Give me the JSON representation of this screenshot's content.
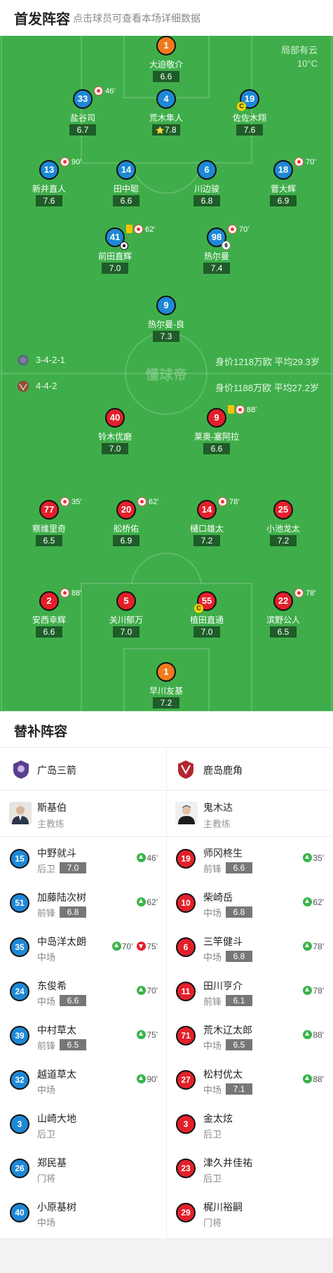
{
  "header": {
    "title": "首发阵容",
    "subtitle": "点击球员可查看本场详细数据"
  },
  "weather": {
    "condition": "局部有云",
    "temperature": "10°C"
  },
  "watermark": "懂球帝",
  "home_team": {
    "name": "广岛三箭",
    "formation": "3-4-2-1",
    "value": "身价1218万欧  平均29.3岁",
    "color": "#5b3f8f"
  },
  "away_team": {
    "name": "鹿岛鹿角",
    "formation": "4-4-2",
    "value": "身价1188万欧  平均27.2岁",
    "color": "#b3262f"
  },
  "home_lineup": [
    {
      "num": "1",
      "name": "大迫敬介",
      "rating": "6.6",
      "kit": "orange"
    },
    {
      "num": "33",
      "name": "盐谷司",
      "rating": "6.7",
      "kit": "blue",
      "sub_out": "46'"
    },
    {
      "num": "4",
      "name": "荒木隼人",
      "rating": "7.8",
      "kit": "blue",
      "mvp": true
    },
    {
      "num": "19",
      "name": "佐佐木翔",
      "rating": "7.6",
      "kit": "blue",
      "captain": "C"
    },
    {
      "num": "13",
      "name": "新井直人",
      "rating": "7.6",
      "kit": "blue",
      "sub_out": "90'"
    },
    {
      "num": "14",
      "name": "田中聪",
      "rating": "6.6",
      "kit": "blue"
    },
    {
      "num": "6",
      "name": "川边骏",
      "rating": "6.8",
      "kit": "blue"
    },
    {
      "num": "18",
      "name": "菅大辉",
      "rating": "6.9",
      "kit": "blue",
      "sub_out": "70'"
    },
    {
      "num": "41",
      "name": "前田直辉",
      "rating": "7.0",
      "kit": "blue",
      "yellow": true,
      "sub_out": "62'",
      "goal": true
    },
    {
      "num": "98",
      "name": "热尔曼",
      "rating": "7.4",
      "kit": "blue",
      "sub_out": "70'",
      "assist": true
    },
    {
      "num": "9",
      "name": "热尔曼-良",
      "rating": "7.3",
      "kit": "blue"
    }
  ],
  "away_lineup": [
    {
      "num": "40",
      "name": "铃木优磨",
      "rating": "7.0",
      "kit": "red"
    },
    {
      "num": "9",
      "name": "莱奥-塞阿拉",
      "rating": "6.6",
      "kit": "red",
      "yellow": true,
      "sub_out": "88'"
    },
    {
      "num": "77",
      "name": "察维里奇",
      "rating": "6.5",
      "kit": "red",
      "sub_out": "35'"
    },
    {
      "num": "20",
      "name": "舩桥佑",
      "rating": "6.9",
      "kit": "red",
      "sub_out": "62'"
    },
    {
      "num": "14",
      "name": "樋口雄太",
      "rating": "7.2",
      "kit": "red",
      "sub_out": "78'"
    },
    {
      "num": "25",
      "name": "小池龙太",
      "rating": "7.2",
      "kit": "red"
    },
    {
      "num": "2",
      "name": "安西幸辉",
      "rating": "6.6",
      "kit": "red",
      "sub_out": "88'"
    },
    {
      "num": "5",
      "name": "关川郁万",
      "rating": "7.0",
      "kit": "red"
    },
    {
      "num": "55",
      "name": "植田直通",
      "rating": "7.0",
      "kit": "red",
      "captain": "C"
    },
    {
      "num": "22",
      "name": "滨野公人",
      "rating": "6.5",
      "kit": "red",
      "sub_out": "78'"
    },
    {
      "num": "1",
      "name": "早川友基",
      "rating": "7.2",
      "kit": "orange"
    }
  ],
  "subs": {
    "title": "替补阵容",
    "home_coach": {
      "name": "斯基伯",
      "role": "主教练"
    },
    "away_coach": {
      "name": "鬼木达",
      "role": "主教练"
    },
    "home": [
      {
        "num": "15",
        "name": "中野就斗",
        "pos": "后卫",
        "rating": "7.0",
        "in": "46'"
      },
      {
        "num": "51",
        "name": "加藤陆次树",
        "pos": "前锋",
        "rating": "6.8",
        "in": "62'"
      },
      {
        "num": "35",
        "name": "中岛洋太朗",
        "pos": "中场",
        "rating": "",
        "in": "70'",
        "out": "75'"
      },
      {
        "num": "24",
        "name": "东俊希",
        "pos": "中场",
        "rating": "6.6",
        "in": "70'"
      },
      {
        "num": "39",
        "name": "中村草太",
        "pos": "前锋",
        "rating": "6.5",
        "in": "75'"
      },
      {
        "num": "32",
        "name": "越道草太",
        "pos": "中场",
        "rating": "",
        "in": "90'"
      },
      {
        "num": "3",
        "name": "山崎大地",
        "pos": "后卫",
        "rating": "",
        "in": ""
      },
      {
        "num": "26",
        "name": "郑民基",
        "pos": "门将",
        "rating": "",
        "in": ""
      },
      {
        "num": "40",
        "name": "小原基树",
        "pos": "中场",
        "rating": "",
        "in": ""
      }
    ],
    "away": [
      {
        "num": "19",
        "name": "师冈柊生",
        "pos": "前锋",
        "rating": "6.6",
        "in": "35'"
      },
      {
        "num": "10",
        "name": "柴崎岳",
        "pos": "中场",
        "rating": "6.8",
        "in": "62'"
      },
      {
        "num": "6",
        "name": "三竿健斗",
        "pos": "中场",
        "rating": "6.8",
        "in": "78'"
      },
      {
        "num": "11",
        "name": "田川亨介",
        "pos": "前锋",
        "rating": "6.1",
        "in": "78'"
      },
      {
        "num": "71",
        "name": "荒木辽太郎",
        "pos": "中场",
        "rating": "6.5",
        "in": "88'"
      },
      {
        "num": "27",
        "name": "松村优太",
        "pos": "中场",
        "rating": "7.1",
        "in": "88'"
      },
      {
        "num": "3",
        "name": "金太炫",
        "pos": "后卫",
        "rating": "",
        "in": ""
      },
      {
        "num": "23",
        "name": "津久井佳祐",
        "pos": "后卫",
        "rating": "",
        "in": ""
      },
      {
        "num": "29",
        "name": "梶川裕嗣",
        "pos": "门将",
        "rating": "",
        "in": ""
      }
    ]
  }
}
